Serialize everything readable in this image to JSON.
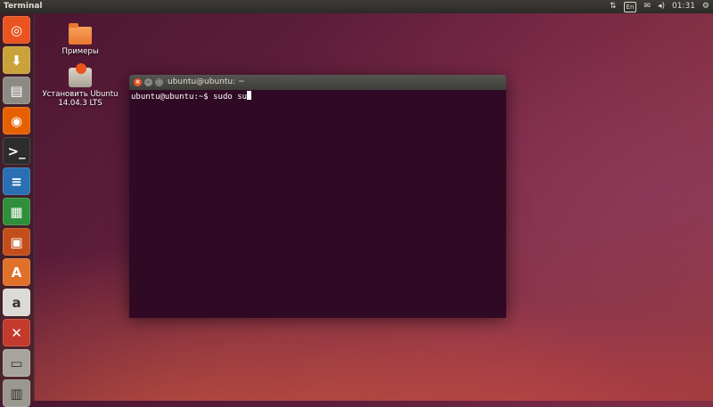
{
  "top_panel": {
    "app_title": "Terminal",
    "network_icon": "arrows-up-down",
    "keyboard_layout": "En",
    "mail_icon": "envelope",
    "volume_icon": "speaker",
    "clock": "01:31",
    "session_icon": "gear"
  },
  "launcher": {
    "items": [
      {
        "name": "dash",
        "icon": "ubuntu-logo",
        "glyph": "◎",
        "color": "#e95420"
      },
      {
        "name": "install",
        "icon": "installer-icon",
        "glyph": "⬇",
        "color": "#c9a33a"
      },
      {
        "name": "files",
        "icon": "files-icon",
        "glyph": "▤",
        "color": "#8d8a84"
      },
      {
        "name": "firefox",
        "icon": "firefox-icon",
        "glyph": "◉",
        "color": "#e66000"
      },
      {
        "name": "terminal",
        "icon": "terminal-icon",
        "glyph": ">_",
        "color": "#2c2c2c"
      },
      {
        "name": "writer",
        "icon": "writer-icon",
        "glyph": "≡",
        "color": "#2a6fb3"
      },
      {
        "name": "calc",
        "icon": "calc-icon",
        "glyph": "▦",
        "color": "#2f8f3a"
      },
      {
        "name": "impress",
        "icon": "impress-icon",
        "glyph": "▣",
        "color": "#c44e1b"
      },
      {
        "name": "software-center",
        "icon": "software-center-icon",
        "glyph": "A",
        "color": "#e0702a"
      },
      {
        "name": "amazon",
        "icon": "amazon-icon",
        "glyph": "a",
        "color": "#dcdad5"
      },
      {
        "name": "settings",
        "icon": "settings-icon",
        "glyph": "✕",
        "color": "#c23b2d"
      },
      {
        "name": "drive",
        "icon": "drive-icon",
        "glyph": "▭",
        "color": "#a7a49d"
      },
      {
        "name": "trash",
        "icon": "trash-icon",
        "glyph": "▥",
        "color": "#9a978f"
      }
    ]
  },
  "desktop": {
    "folder_label": "Примеры",
    "installer_label_line1": "Установить Ubuntu",
    "installer_label_line2": "14.04.3 LTS"
  },
  "terminal": {
    "title": "ubuntu@ubuntu: ~",
    "prompt": "ubuntu@ubuntu:~$ ",
    "command": "sudo su"
  }
}
